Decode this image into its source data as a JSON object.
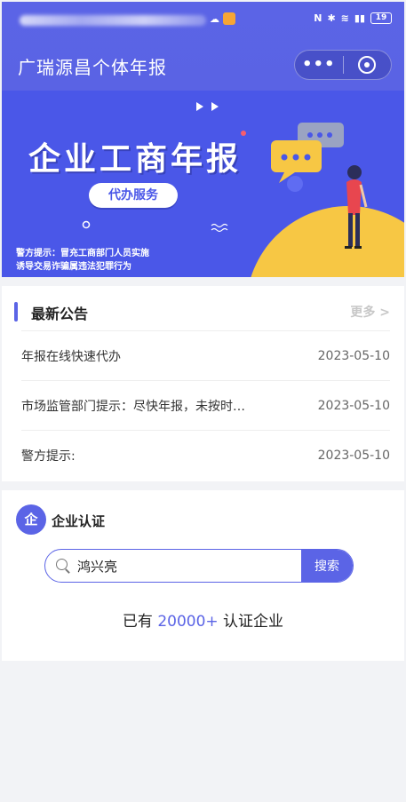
{
  "status_bar": {
    "battery": "19"
  },
  "header": {
    "title": "广瑞源昌个体年报",
    "menu_glyph": "•••"
  },
  "banner": {
    "headline": "企业工商年报",
    "pill": "代办服务",
    "warning_line1": "警方提示：冒充工商部门人员实施",
    "warning_line2": "诱导交易诈骗属违法犯罪行为"
  },
  "notices": {
    "title": "最新公告",
    "more": "更多 >",
    "items": [
      {
        "text": "年报在线快速代办",
        "date": "2023-05-10"
      },
      {
        "text": "市场监管部门提示：尽快年报，未按时…",
        "date": "2023-05-10"
      },
      {
        "text": "警方提示:",
        "date": "2023-05-10"
      }
    ]
  },
  "certification": {
    "logo_char": "企",
    "title": "企业认证",
    "search_value": "鸿兴亮",
    "search_button": "搜索",
    "count_prefix": "已有 ",
    "count_value": "20000+",
    "count_suffix": " 认证企业"
  },
  "colors": {
    "brand": "#5b64e6",
    "banner_bg": "#4a57e8",
    "accent_yellow": "#f7c744"
  }
}
